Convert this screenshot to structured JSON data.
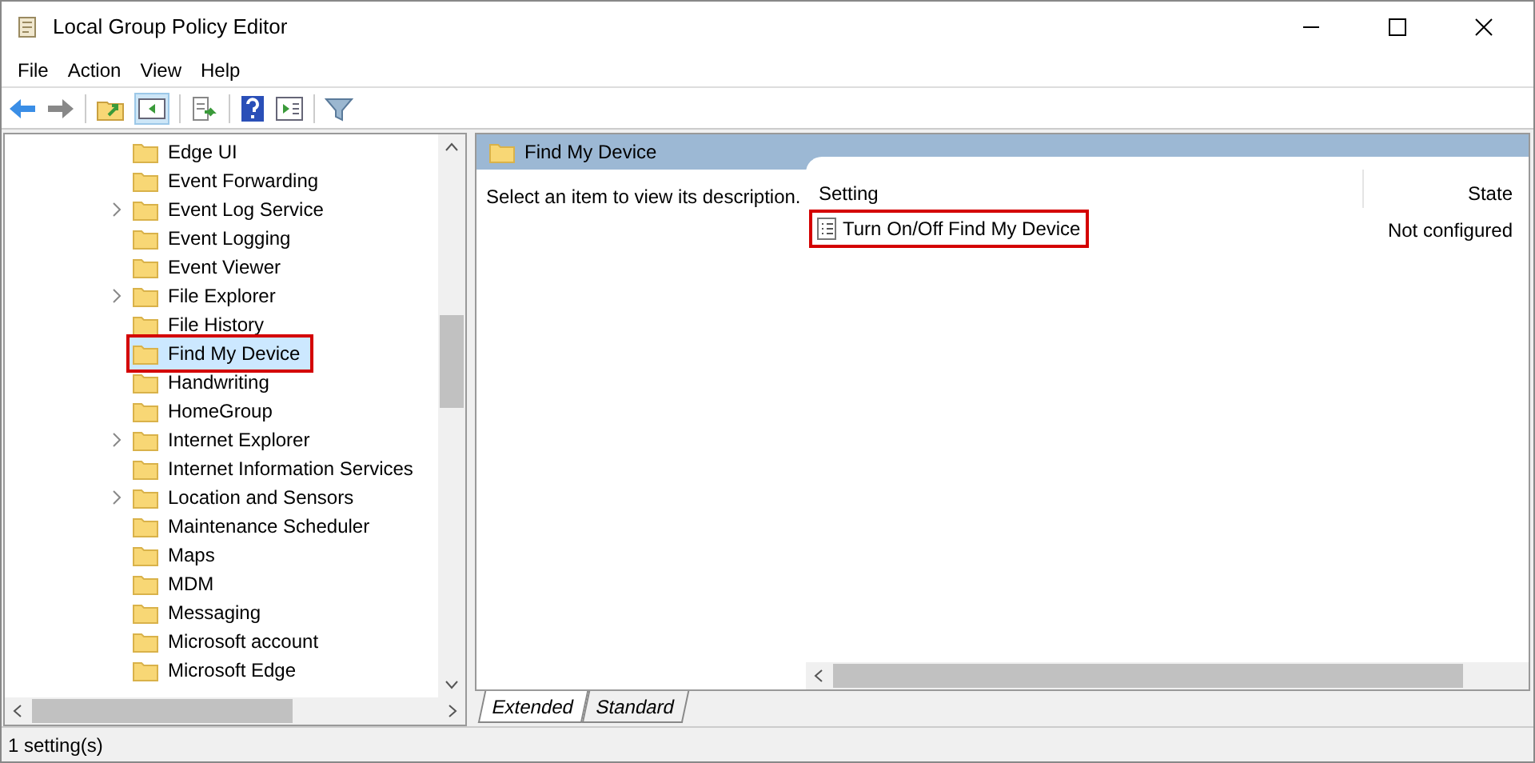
{
  "window": {
    "title": "Local Group Policy Editor"
  },
  "menu": [
    "File",
    "Action",
    "View",
    "Help"
  ],
  "tree": {
    "items": [
      {
        "label": "Edge UI",
        "expandable": false,
        "selected": false,
        "outlined": false
      },
      {
        "label": "Event Forwarding",
        "expandable": false,
        "selected": false,
        "outlined": false
      },
      {
        "label": "Event Log Service",
        "expandable": true,
        "selected": false,
        "outlined": false
      },
      {
        "label": "Event Logging",
        "expandable": false,
        "selected": false,
        "outlined": false
      },
      {
        "label": "Event Viewer",
        "expandable": false,
        "selected": false,
        "outlined": false
      },
      {
        "label": "File Explorer",
        "expandable": true,
        "selected": false,
        "outlined": false
      },
      {
        "label": "File History",
        "expandable": false,
        "selected": false,
        "outlined": false
      },
      {
        "label": "Find My Device",
        "expandable": false,
        "selected": true,
        "outlined": true
      },
      {
        "label": "Handwriting",
        "expandable": false,
        "selected": false,
        "outlined": false
      },
      {
        "label": "HomeGroup",
        "expandable": false,
        "selected": false,
        "outlined": false
      },
      {
        "label": "Internet Explorer",
        "expandable": true,
        "selected": false,
        "outlined": false
      },
      {
        "label": "Internet Information Services",
        "expandable": false,
        "selected": false,
        "outlined": false
      },
      {
        "label": "Location and Sensors",
        "expandable": true,
        "selected": false,
        "outlined": false
      },
      {
        "label": "Maintenance Scheduler",
        "expandable": false,
        "selected": false,
        "outlined": false
      },
      {
        "label": "Maps",
        "expandable": false,
        "selected": false,
        "outlined": false
      },
      {
        "label": "MDM",
        "expandable": false,
        "selected": false,
        "outlined": false
      },
      {
        "label": "Messaging",
        "expandable": false,
        "selected": false,
        "outlined": false
      },
      {
        "label": "Microsoft account",
        "expandable": false,
        "selected": false,
        "outlined": false
      },
      {
        "label": "Microsoft Edge",
        "expandable": false,
        "selected": false,
        "outlined": false
      }
    ]
  },
  "details": {
    "header": "Find My Device",
    "description": "Select an item to view its description.",
    "columns": [
      "Setting",
      "State"
    ],
    "rows": [
      {
        "setting": "Turn On/Off Find My Device",
        "state": "Not configured",
        "outlined": true
      }
    ]
  },
  "tabs": [
    {
      "label": "Extended",
      "selected": true
    },
    {
      "label": "Standard",
      "selected": false
    }
  ],
  "status_bar": "1 setting(s)"
}
